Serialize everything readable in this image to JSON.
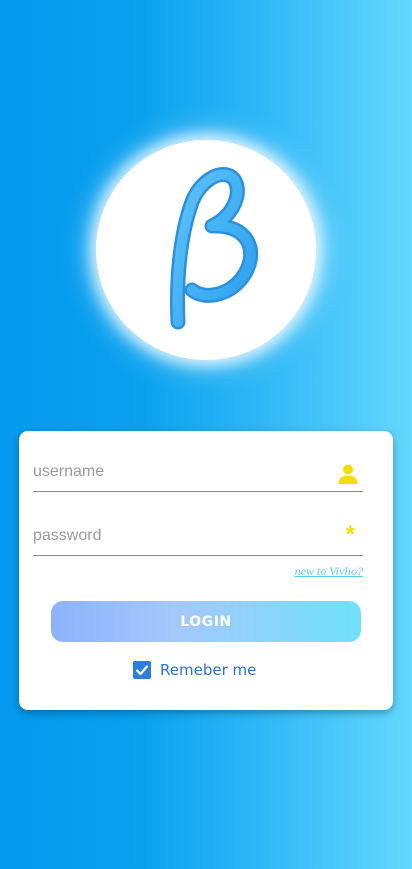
{
  "logo": {
    "letter": "β",
    "icon": "beta-logo-icon"
  },
  "login_form": {
    "username": {
      "placeholder": "username",
      "value": "",
      "icon": "user-icon"
    },
    "password": {
      "placeholder": "password",
      "value": "",
      "icon": "asterisk-icon",
      "icon_glyph": "*"
    },
    "signup_link": "new to Vivlio?",
    "login_button": "LOGIN",
    "remember_me": {
      "label": "Remeber me",
      "checked": true
    }
  },
  "colors": {
    "background_start": "#0399ee",
    "background_end": "#64d8fd",
    "accent_yellow": "#f5dc0a",
    "checkbox_blue": "#2c7ee0",
    "link_cyan": "#56cce8"
  }
}
